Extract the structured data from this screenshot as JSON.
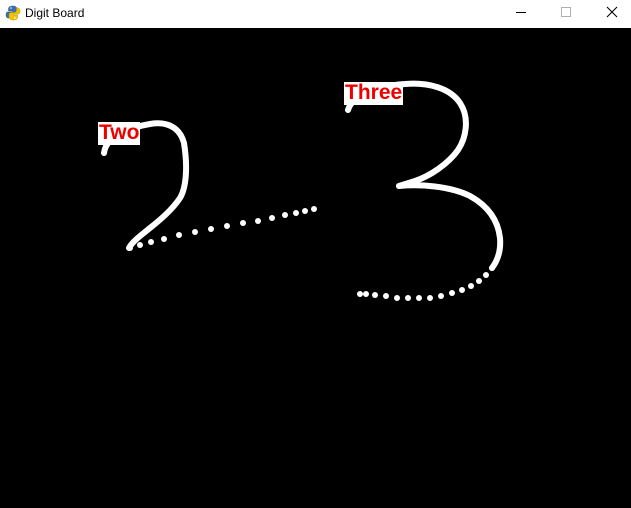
{
  "window": {
    "title": "Digit Board",
    "icon": "python-snake-icon"
  },
  "controls": {
    "minimize": "minimize-icon",
    "maximize": "maximize-icon",
    "close": "close-icon"
  },
  "board": {
    "background": "#000000",
    "stroke_color": "#ffffff",
    "label_color": "#ee0000",
    "label_background": "#ffffff",
    "labels": [
      {
        "text": "Two"
      },
      {
        "text": "Three"
      }
    ]
  }
}
